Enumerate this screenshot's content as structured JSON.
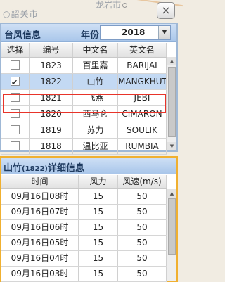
{
  "map": {
    "city_left": "○韶关市",
    "city_right": "龙岩市",
    "close_icon": "×"
  },
  "typhoon_panel": {
    "title": "台风信息",
    "year_label": "年份",
    "year_value": "2018",
    "columns": [
      "选择",
      "编号",
      "中文名",
      "英文名"
    ],
    "rows": [
      {
        "checked": false,
        "id": "1823",
        "cn": "百里嘉",
        "en": "BARIJAI"
      },
      {
        "checked": true,
        "id": "1822",
        "cn": "山竹",
        "en": "MANGKHUT"
      },
      {
        "checked": false,
        "id": "1821",
        "cn": "飞燕",
        "en": "JEBI"
      },
      {
        "checked": false,
        "id": "1820",
        "cn": "西马仑",
        "en": "CIMARON"
      },
      {
        "checked": false,
        "id": "1819",
        "cn": "苏力",
        "en": "SOULIK"
      },
      {
        "checked": false,
        "id": "1818",
        "cn": "温比亚",
        "en": "RUMBIA"
      }
    ],
    "selection_color": "#e8342a"
  },
  "detail_panel": {
    "title_prefix": "山竹",
    "title_code": "(1822)",
    "title_suffix": "详细信息",
    "columns": [
      "时间",
      "风力",
      "风速(m/s)"
    ],
    "rows": [
      {
        "time": "09月16日08时",
        "force": "15",
        "speed": "50"
      },
      {
        "time": "09月16日07时",
        "force": "15",
        "speed": "50"
      },
      {
        "time": "09月16日06时",
        "force": "15",
        "speed": "50"
      },
      {
        "time": "09月16日05时",
        "force": "15",
        "speed": "50"
      },
      {
        "time": "09月16日04时",
        "force": "15",
        "speed": "50"
      },
      {
        "time": "09月16日03时",
        "force": "15",
        "speed": "50"
      }
    ],
    "border_color": "#f0b030"
  }
}
